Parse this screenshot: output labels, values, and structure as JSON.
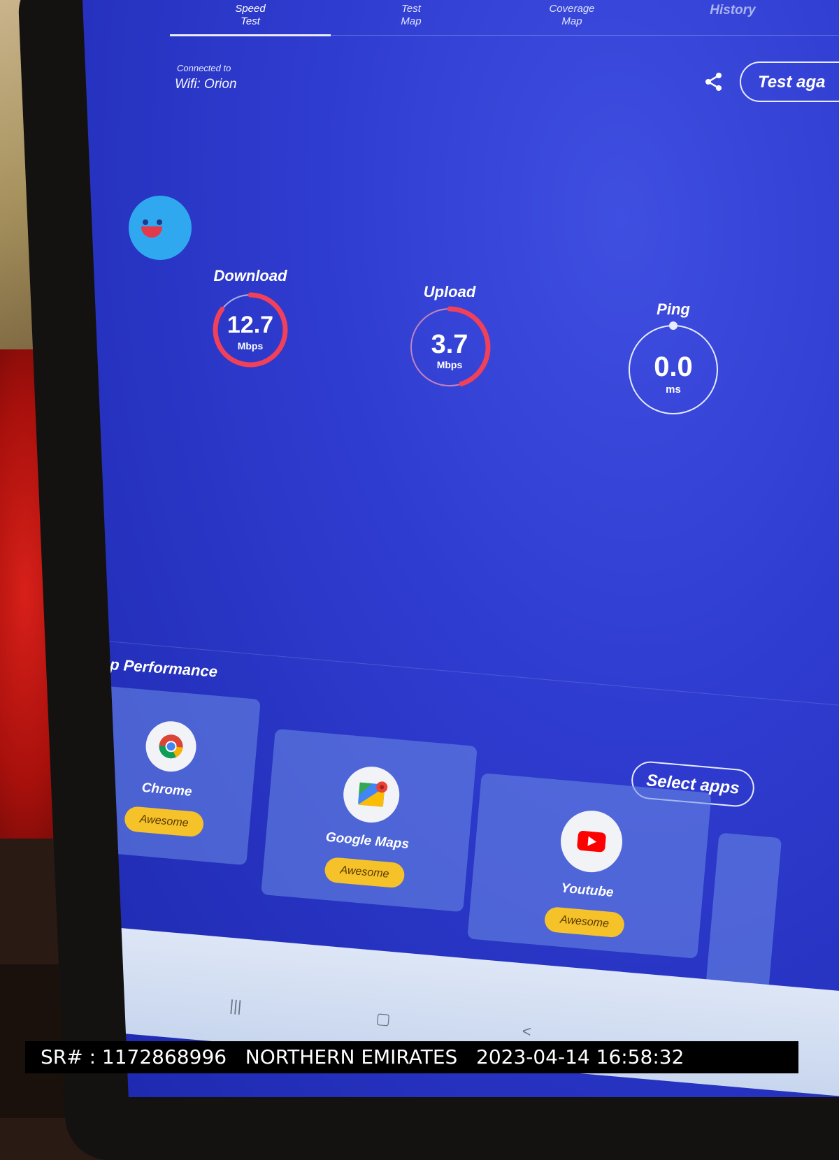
{
  "tabs": [
    {
      "label": "Speed\nTest",
      "active": true
    },
    {
      "label": "Test\nMap",
      "active": false
    },
    {
      "label": "Coverage\nMap",
      "active": false
    },
    {
      "label": "History",
      "active": false
    }
  ],
  "connection": {
    "label": "Connected to",
    "value": "Wifi: Orion"
  },
  "header": {
    "test_again_label": "Test aga"
  },
  "metrics": {
    "download": {
      "label": "Download",
      "value": "12.7",
      "unit": "Mbps",
      "gauge_fraction": 0.85,
      "color": "#f0405a"
    },
    "upload": {
      "label": "Upload",
      "value": "3.7",
      "unit": "Mbps",
      "gauge_fraction": 0.45,
      "color": "#f0405a"
    },
    "ping": {
      "label": "Ping",
      "value": "0.0",
      "unit": "ms",
      "gauge_fraction": 0.0,
      "color": "#e8ebff"
    }
  },
  "app_performance": {
    "title": "App Performance",
    "select_apps_label": "Select apps",
    "apps": [
      {
        "name": "Chrome",
        "rating": "Awesome",
        "icon": "chrome-icon"
      },
      {
        "name": "Google Maps",
        "rating": "Awesome",
        "icon": "google-maps-icon"
      },
      {
        "name": "Youtube",
        "rating": "Awesome",
        "icon": "youtube-icon"
      }
    ]
  },
  "navbar": {
    "recents_icon": "|||",
    "home_icon": "▢",
    "back_icon": "<"
  },
  "caption": {
    "text": "SR# : 1172868996   NORTHERN EMIRATES   2023-04-14 16:58:32"
  },
  "colors": {
    "screen_bg": "#2f3cd0",
    "accent_badge": "#f6c22a",
    "gauge_active": "#f0405a"
  }
}
